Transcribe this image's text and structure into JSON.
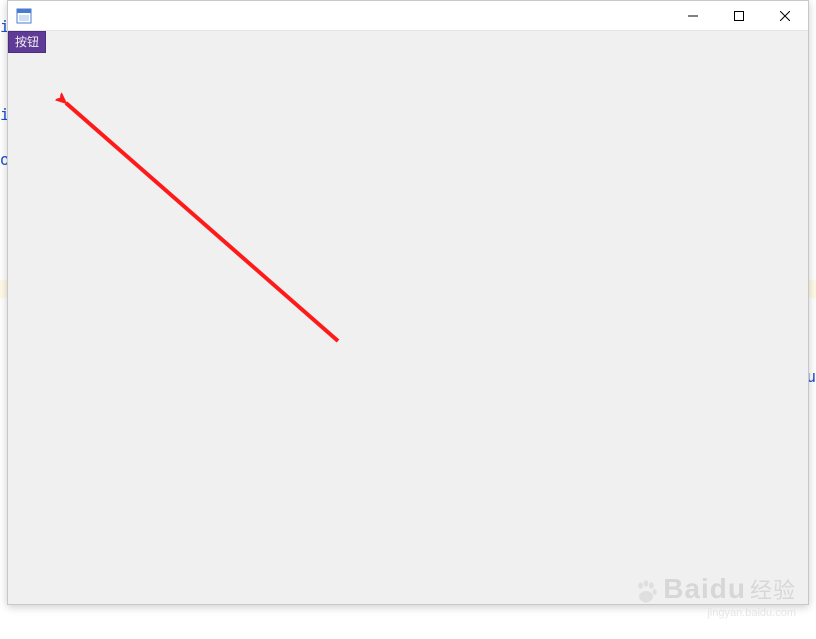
{
  "background": {
    "frag1": "i",
    "frag2": "i",
    "frag3": "o",
    "frag4": "u"
  },
  "window": {
    "title": ""
  },
  "button": {
    "label": "按钮"
  },
  "annotation": {
    "arrow_color": "#ff1a1a"
  },
  "watermark": {
    "brand": "Baidu",
    "product": "经验",
    "url": "jingyan.baidu.com"
  }
}
